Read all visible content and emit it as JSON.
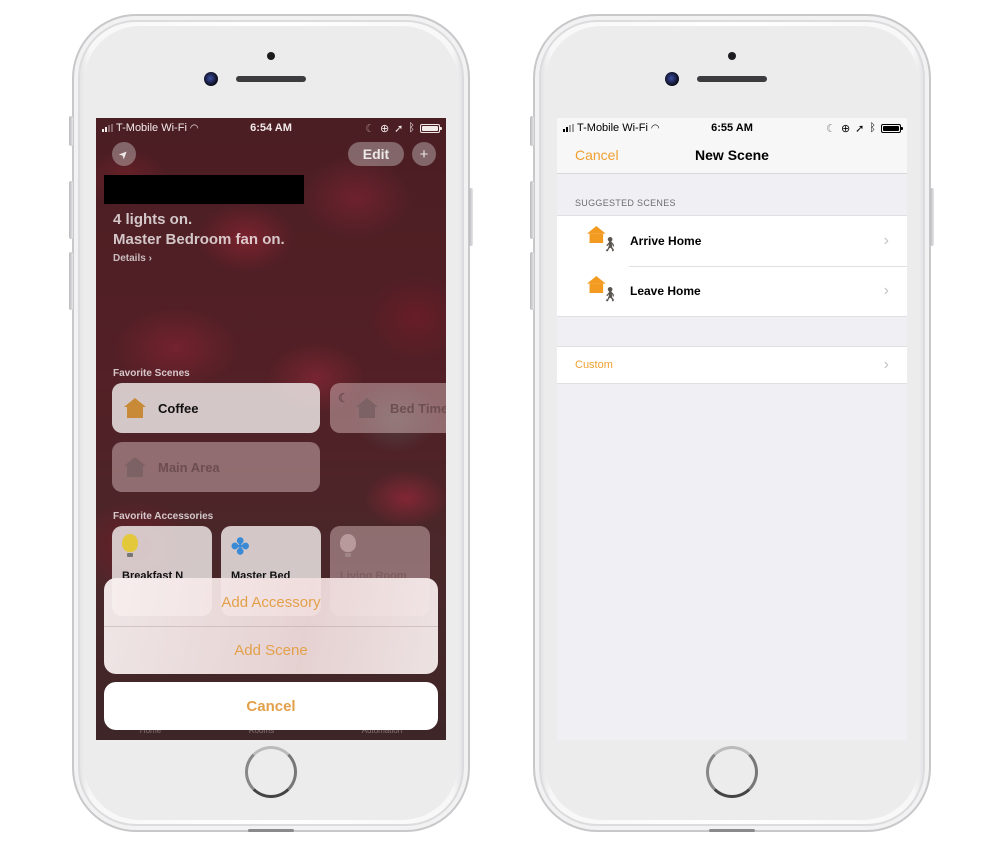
{
  "phones": [
    {
      "status_bar": {
        "carrier": "T-Mobile Wi-Fi",
        "time": "6:54 AM",
        "icons": [
          "signal-icon",
          "wifi-icon",
          "moon-icon",
          "orientation-lock-icon",
          "location-icon",
          "bluetooth-icon",
          "battery-icon"
        ]
      },
      "home": {
        "location_icon": "➤",
        "edit_label": "Edit",
        "add_icon": "+",
        "status_lines": [
          "4 lights on.",
          "Master Bedroom fan on."
        ],
        "details_label": "Details ›",
        "favorite_scenes_label": "Favorite Scenes",
        "scenes": [
          {
            "name": "Coffee",
            "state": "on",
            "icon": "house-icon",
            "color": "#c88a36"
          },
          {
            "name": "Bed Time",
            "state": "off",
            "icon": "house-moon-icon"
          },
          {
            "name": "Main Area",
            "state": "off",
            "icon": "house-icon"
          }
        ],
        "favorite_accessories_label": "Favorite Accessories",
        "accessories": [
          {
            "name": "Breakfast N",
            "state": "on",
            "icon": "lightbulb-icon",
            "color": "#e2c83a"
          },
          {
            "name": "Master Bed",
            "state": "on",
            "icon": "fan-icon",
            "color": "#3b8ad6"
          },
          {
            "name": "Living Room",
            "state": "off",
            "icon": "lightbulb-icon",
            "color": "#b89a9c"
          }
        ],
        "tabs": [
          "Home",
          "Rooms",
          "Automation"
        ]
      },
      "action_sheet": {
        "items": [
          "Add Accessory",
          "Add Scene"
        ],
        "cancel_label": "Cancel",
        "accent_color": "#e3a04a"
      }
    },
    {
      "status_bar": {
        "carrier": "T-Mobile Wi-Fi",
        "time": "6:55 AM",
        "icons": [
          "signal-icon",
          "wifi-icon",
          "moon-icon",
          "orientation-lock-icon",
          "location-icon",
          "bluetooth-icon",
          "battery-icon"
        ]
      },
      "nav": {
        "cancel_label": "Cancel",
        "title": "New Scene"
      },
      "suggested_header": "SUGGESTED SCENES",
      "suggested": [
        {
          "label": "Arrive Home",
          "icon": "arrive-home-icon"
        },
        {
          "label": "Leave Home",
          "icon": "leave-home-icon"
        }
      ],
      "custom_label": "Custom",
      "accent_color": "#f0a030"
    }
  ]
}
